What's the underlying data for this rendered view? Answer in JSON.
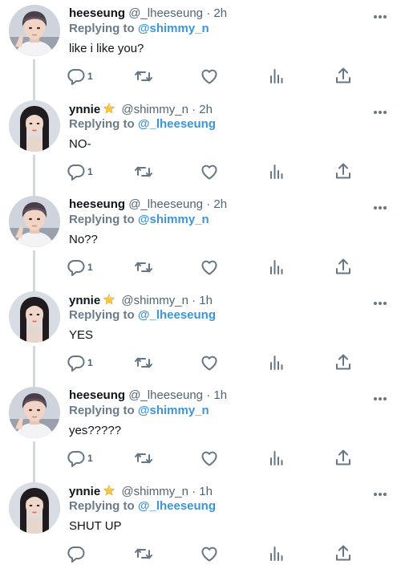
{
  "replying_label": "Replying to",
  "colors": {
    "handle_link": "#3d95d9",
    "icon": "#657786",
    "star": "#f6c744"
  },
  "tweets": [
    {
      "name": "heeseung",
      "has_star": false,
      "handle": "@_lheeseung",
      "dot": "·",
      "time": "2h",
      "reply_to": "@shimmy_n",
      "text": "like i like you?",
      "reply_count": "1",
      "avatar": "heeseung"
    },
    {
      "name": "ynnie",
      "has_star": true,
      "handle": "@shimmy_n",
      "dot": "·",
      "time": "2h",
      "reply_to": "@_lheeseung",
      "text": "NO-",
      "reply_count": "1",
      "avatar": "ynnie"
    },
    {
      "name": "heeseung",
      "has_star": false,
      "handle": "@_lheeseung",
      "dot": "·",
      "time": "2h",
      "reply_to": "@shimmy_n",
      "text": "No??",
      "reply_count": "1",
      "avatar": "heeseung"
    },
    {
      "name": "ynnie",
      "has_star": true,
      "handle": "@shimmy_n",
      "dot": "·",
      "time": "1h",
      "reply_to": "@_lheeseung",
      "text": "YES",
      "reply_count": "1",
      "avatar": "ynnie"
    },
    {
      "name": "heeseung",
      "has_star": false,
      "handle": "@_lheeseung",
      "dot": "·",
      "time": "1h",
      "reply_to": "@shimmy_n",
      "text": "yes?????",
      "reply_count": "1",
      "avatar": "heeseung"
    },
    {
      "name": "ynnie",
      "has_star": true,
      "handle": "@shimmy_n",
      "dot": "·",
      "time": "1h",
      "reply_to": "@_lheeseung",
      "text": "SHUT UP",
      "reply_count": "",
      "avatar": "ynnie"
    }
  ]
}
